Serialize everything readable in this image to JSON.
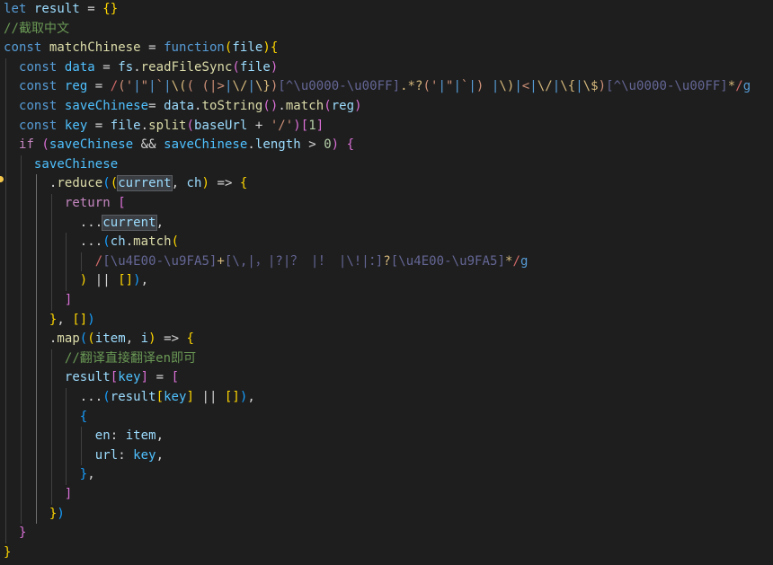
{
  "editor": {
    "theme": "dark",
    "colors": {
      "background": "#1e1e1e",
      "keyword": "#569cd6",
      "control": "#c586c0",
      "variable": "#9cdcfe",
      "constant": "#4fc1ff",
      "function": "#dcdcaa",
      "string": "#ce9178",
      "comment": "#6a9955",
      "number": "#b5cea8",
      "bracket1": "#ffd700",
      "bracket2": "#da70d6",
      "bracket3": "#179fff",
      "regexDelimiter": "#d16969",
      "regexClass": "#646695",
      "regexEscape": "#d7ba7d",
      "lightbulb": "#f4c74b"
    },
    "gutter_marker": "lightbulb-icon",
    "lines": [
      [
        [
          "kw",
          "let"
        ],
        [
          "op",
          " "
        ],
        [
          "var",
          "result"
        ],
        [
          "op",
          " = "
        ],
        [
          "b1",
          "{}"
        ]
      ],
      [
        [
          "cmt",
          "//截取中文"
        ]
      ],
      [
        [
          "kw",
          "const"
        ],
        [
          "op",
          " "
        ],
        [
          "fn",
          "matchChinese"
        ],
        [
          "op",
          " = "
        ],
        [
          "kw",
          "function"
        ],
        [
          "b1",
          "("
        ],
        [
          "var",
          "file"
        ],
        [
          "b1",
          ")"
        ],
        [
          "b1",
          "{"
        ]
      ],
      [
        [
          "op",
          "  "
        ],
        [
          "kw",
          "const"
        ],
        [
          "op",
          " "
        ],
        [
          "cst",
          "data"
        ],
        [
          "op",
          " = "
        ],
        [
          "var",
          "fs"
        ],
        [
          "pun",
          "."
        ],
        [
          "fn",
          "readFileSync"
        ],
        [
          "b2",
          "("
        ],
        [
          "var",
          "file"
        ],
        [
          "b2",
          ")"
        ]
      ],
      [
        [
          "op",
          "  "
        ],
        [
          "kw",
          "const"
        ],
        [
          "op",
          " "
        ],
        [
          "cst",
          "reg"
        ],
        [
          "op",
          " = "
        ],
        [
          "rxd",
          "/"
        ],
        [
          "rxg",
          "("
        ],
        [
          "str",
          "'"
        ],
        [
          "rxa",
          "|"
        ],
        [
          "str",
          "\""
        ],
        [
          "rxa",
          "|"
        ],
        [
          "str",
          "`"
        ],
        [
          "rxa",
          "|"
        ],
        [
          "rxe",
          "\\("
        ],
        [
          "rxg",
          "("
        ],
        [
          "str",
          " "
        ],
        [
          "rxg",
          "("
        ],
        [
          "str",
          "|>"
        ],
        [
          "rxa",
          "|"
        ],
        [
          "rxe",
          "\\/"
        ],
        [
          "rxa",
          "|"
        ],
        [
          "rxe",
          "\\}"
        ],
        [
          "rxg",
          ")"
        ],
        [
          "rxc",
          "[^\\u0000-\\u00FF]"
        ],
        [
          "rxe",
          ".*?"
        ],
        [
          "rxg",
          "("
        ],
        [
          "str",
          "'"
        ],
        [
          "rxa",
          "|"
        ],
        [
          "str",
          "\""
        ],
        [
          "rxa",
          "|"
        ],
        [
          "str",
          "`"
        ],
        [
          "rxa",
          "|"
        ],
        [
          "rxg",
          ")"
        ],
        [
          "str",
          " "
        ],
        [
          "rxa",
          "|"
        ],
        [
          "rxe",
          "\\)"
        ],
        [
          "rxa",
          "|"
        ],
        [
          "str",
          "<"
        ],
        [
          "rxa",
          "|"
        ],
        [
          "rxe",
          "\\/"
        ],
        [
          "rxa",
          "|"
        ],
        [
          "rxe",
          "\\{"
        ],
        [
          "rxa",
          "|"
        ],
        [
          "rxe",
          "\\$"
        ],
        [
          "rxg",
          ")"
        ],
        [
          "rxc",
          "[^\\u0000-\\u00FF]"
        ],
        [
          "rxe",
          "*"
        ],
        [
          "rxd",
          "/"
        ],
        [
          "kw",
          "g"
        ]
      ],
      [
        [
          "op",
          "  "
        ],
        [
          "kw",
          "const"
        ],
        [
          "op",
          " "
        ],
        [
          "cst",
          "saveChinese"
        ],
        [
          "op",
          "= "
        ],
        [
          "var",
          "data"
        ],
        [
          "pun",
          "."
        ],
        [
          "fn",
          "toString"
        ],
        [
          "b2",
          "()"
        ],
        [
          "pun",
          "."
        ],
        [
          "fn",
          "match"
        ],
        [
          "b2",
          "("
        ],
        [
          "var",
          "reg"
        ],
        [
          "b2",
          ")"
        ]
      ],
      [
        [
          "op",
          "  "
        ],
        [
          "kw",
          "const"
        ],
        [
          "op",
          " "
        ],
        [
          "cst",
          "key"
        ],
        [
          "op",
          " = "
        ],
        [
          "var",
          "file"
        ],
        [
          "pun",
          "."
        ],
        [
          "fn",
          "split"
        ],
        [
          "b2",
          "("
        ],
        [
          "var",
          "baseUrl"
        ],
        [
          "op",
          " + "
        ],
        [
          "str",
          "'/'"
        ],
        [
          "b2",
          ")"
        ],
        [
          "b2",
          "["
        ],
        [
          "num",
          "1"
        ],
        [
          "b2",
          "]"
        ]
      ],
      [
        [
          "op",
          "  "
        ],
        [
          "ctl",
          "if"
        ],
        [
          "op",
          " "
        ],
        [
          "b2",
          "("
        ],
        [
          "cst",
          "saveChinese"
        ],
        [
          "op",
          " && "
        ],
        [
          "cst",
          "saveChinese"
        ],
        [
          "pun",
          "."
        ],
        [
          "var",
          "length"
        ],
        [
          "op",
          " > "
        ],
        [
          "num",
          "0"
        ],
        [
          "b2",
          ")"
        ],
        [
          "op",
          " "
        ],
        [
          "b2",
          "{"
        ]
      ],
      [
        [
          "op",
          "    "
        ],
        [
          "cst",
          "saveChinese"
        ]
      ],
      [
        [
          "op",
          "      "
        ],
        [
          "pun",
          "."
        ],
        [
          "fn",
          "reduce"
        ],
        [
          "b3",
          "("
        ],
        [
          "b1",
          "("
        ],
        [
          "var",
          "current"
        ],
        [
          "pun",
          ", "
        ],
        [
          "var",
          "ch"
        ],
        [
          "b1",
          ")"
        ],
        [
          "op",
          " => "
        ],
        [
          "b1",
          "{"
        ]
      ],
      [
        [
          "op",
          "        "
        ],
        [
          "ctl",
          "return"
        ],
        [
          "op",
          " "
        ],
        [
          "b2",
          "["
        ]
      ],
      [
        [
          "op",
          "          "
        ],
        [
          "op",
          "..."
        ],
        [
          "var",
          "current"
        ],
        [
          "pun",
          ","
        ]
      ],
      [
        [
          "op",
          "          "
        ],
        [
          "op",
          "..."
        ],
        [
          "b3",
          "("
        ],
        [
          "var",
          "ch"
        ],
        [
          "pun",
          "."
        ],
        [
          "fn",
          "match"
        ],
        [
          "b1",
          "("
        ]
      ],
      [
        [
          "op",
          "            "
        ],
        [
          "rxd",
          "/"
        ],
        [
          "rxc",
          "[\\u4E00-\\u9FA5]"
        ],
        [
          "rxe",
          "+"
        ],
        [
          "rxc",
          "[\\,|，|?|？ |！ |\\!|：]"
        ],
        [
          "rxe",
          "?"
        ],
        [
          "rxc",
          "[\\u4E00-\\u9FA5]"
        ],
        [
          "rxe",
          "*"
        ],
        [
          "rxd",
          "/"
        ],
        [
          "kw",
          "g"
        ]
      ],
      [
        [
          "op",
          "          "
        ],
        [
          "b1",
          ")"
        ],
        [
          "op",
          " || "
        ],
        [
          "b1",
          "[]"
        ],
        [
          "b3",
          ")"
        ],
        [
          "pun",
          ","
        ]
      ],
      [
        [
          "op",
          "        "
        ],
        [
          "b2",
          "]"
        ]
      ],
      [
        [
          "op",
          "      "
        ],
        [
          "b1",
          "}"
        ],
        [
          "pun",
          ", "
        ],
        [
          "b1",
          "[]"
        ],
        [
          "b3",
          ")"
        ]
      ],
      [
        [
          "op",
          "      "
        ],
        [
          "pun",
          "."
        ],
        [
          "fn",
          "map"
        ],
        [
          "b3",
          "("
        ],
        [
          "b1",
          "("
        ],
        [
          "var",
          "item"
        ],
        [
          "pun",
          ", "
        ],
        [
          "var",
          "i"
        ],
        [
          "b1",
          ")"
        ],
        [
          "op",
          " => "
        ],
        [
          "b1",
          "{"
        ]
      ],
      [
        [
          "op",
          "        "
        ],
        [
          "cmt",
          "//翻译直接翻译en即可"
        ]
      ],
      [
        [
          "op",
          "        "
        ],
        [
          "var",
          "result"
        ],
        [
          "b2",
          "["
        ],
        [
          "cst",
          "key"
        ],
        [
          "b2",
          "]"
        ],
        [
          "op",
          " = "
        ],
        [
          "b2",
          "["
        ]
      ],
      [
        [
          "op",
          "          "
        ],
        [
          "op",
          "..."
        ],
        [
          "b3",
          "("
        ],
        [
          "var",
          "result"
        ],
        [
          "b1",
          "["
        ],
        [
          "cst",
          "key"
        ],
        [
          "b1",
          "]"
        ],
        [
          "op",
          " || "
        ],
        [
          "b1",
          "[]"
        ],
        [
          "b3",
          ")"
        ],
        [
          "pun",
          ","
        ]
      ],
      [
        [
          "op",
          "          "
        ],
        [
          "b3",
          "{"
        ]
      ],
      [
        [
          "op",
          "            "
        ],
        [
          "var",
          "en"
        ],
        [
          "pun",
          ": "
        ],
        [
          "var",
          "item"
        ],
        [
          "pun",
          ","
        ]
      ],
      [
        [
          "op",
          "            "
        ],
        [
          "var",
          "url"
        ],
        [
          "pun",
          ": "
        ],
        [
          "cst",
          "key"
        ],
        [
          "pun",
          ","
        ]
      ],
      [
        [
          "op",
          "          "
        ],
        [
          "b3",
          "}"
        ],
        [
          "pun",
          ","
        ]
      ],
      [
        [
          "op",
          "        "
        ],
        [
          "b2",
          "]"
        ]
      ],
      [
        [
          "op",
          "      "
        ],
        [
          "b1",
          "}"
        ],
        [
          "b3",
          ")"
        ]
      ],
      [
        [
          "op",
          "  "
        ],
        [
          "b2",
          "}"
        ]
      ],
      [
        [
          "b1",
          "}"
        ]
      ]
    ]
  }
}
